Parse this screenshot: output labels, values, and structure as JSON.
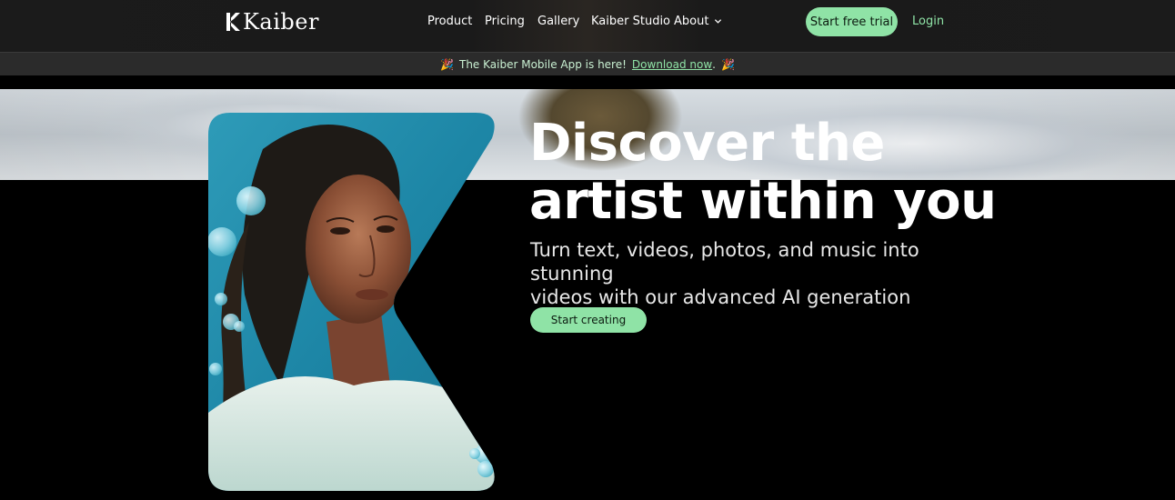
{
  "brand": {
    "name": "Kaiber"
  },
  "nav": {
    "items": [
      {
        "label": "Product"
      },
      {
        "label": "Pricing"
      },
      {
        "label": "Gallery"
      },
      {
        "label": "Kaiber Studio"
      },
      {
        "label": "About"
      }
    ],
    "cta_label": "Start free trial",
    "login_label": "Login"
  },
  "announcement": {
    "prefix": "The Kaiber Mobile App is here!",
    "link_text": "Download now",
    "suffix": "."
  },
  "hero": {
    "title_line1": "Discover the",
    "title_line2": "artist within you",
    "subtitle_line1": "Turn text, videos, photos, and music into stunning",
    "subtitle_line2": "videos with our advanced AI generation engine.",
    "cta_label": "Start creating"
  },
  "colors": {
    "accent": "#8fe3a6",
    "background": "#000000",
    "header": "#1b1b1b",
    "banner": "#2b2b2b"
  },
  "icons": [
    "kaiber-logo-icon",
    "chevron-down-icon",
    "party-popper-icon"
  ]
}
